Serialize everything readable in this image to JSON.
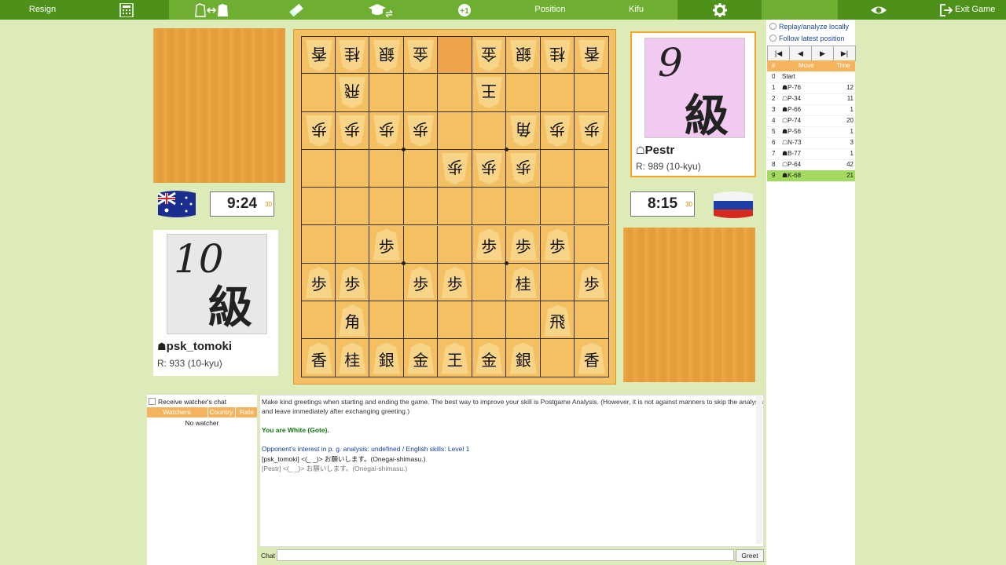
{
  "toolbar": {
    "resign": "Resign",
    "position": "Position",
    "kifu": "Kifu",
    "exit": "Exit Game"
  },
  "board": {
    "rows": [
      [
        [
          "香",
          "g"
        ],
        [
          "桂",
          "g"
        ],
        [
          "銀",
          "g"
        ],
        [
          "金",
          "g"
        ],
        null,
        [
          "金",
          "g"
        ],
        [
          "銀",
          "g"
        ],
        [
          "桂",
          "g"
        ],
        [
          "香",
          "g"
        ]
      ],
      [
        null,
        [
          "飛",
          "g"
        ],
        null,
        null,
        null,
        [
          "王",
          "g"
        ],
        null,
        null,
        null
      ],
      [
        [
          "歩",
          "g"
        ],
        [
          "歩",
          "g"
        ],
        [
          "歩",
          "g"
        ],
        [
          "歩",
          "g"
        ],
        null,
        null,
        [
          "角",
          "g"
        ],
        [
          "歩",
          "g"
        ],
        [
          "歩",
          "g"
        ]
      ],
      [
        null,
        null,
        null,
        null,
        [
          "歩",
          "g"
        ],
        [
          "歩",
          "g"
        ],
        [
          "歩",
          "g"
        ],
        null,
        null
      ],
      [
        null,
        null,
        null,
        null,
        null,
        null,
        null,
        null,
        null
      ],
      [
        null,
        null,
        [
          "歩",
          "s"
        ],
        null,
        null,
        [
          "歩",
          "s"
        ],
        [
          "歩",
          "s"
        ],
        [
          "歩",
          "s"
        ],
        null
      ],
      [
        [
          "歩",
          "s"
        ],
        [
          "歩",
          "s"
        ],
        null,
        [
          "歩",
          "s"
        ],
        [
          "歩",
          "s"
        ],
        null,
        [
          "桂",
          "s"
        ],
        null,
        [
          "歩",
          "s"
        ]
      ],
      [
        null,
        [
          "角",
          "s"
        ],
        null,
        null,
        null,
        null,
        null,
        [
          "飛",
          "s"
        ],
        null
      ],
      [
        [
          "香",
          "s"
        ],
        [
          "桂",
          "s"
        ],
        [
          "銀",
          "s"
        ],
        [
          "金",
          "s"
        ],
        [
          "王",
          "s"
        ],
        [
          "金",
          "s"
        ],
        [
          "銀",
          "s"
        ],
        null,
        [
          "香",
          "s"
        ]
      ]
    ],
    "highlight": [
      0,
      4
    ]
  },
  "players": {
    "sente": {
      "name": "psk_tomoki",
      "rating": "R: 933 (10-kyu)",
      "rank_num": "10",
      "rank_kanji": "級",
      "clock": "9:24",
      "byoyomi": "30",
      "country": "Australia"
    },
    "gote": {
      "name": "Pestr",
      "rating": "R: 989 (10-kyu)",
      "rank_num": "9",
      "rank_kanji": "級",
      "clock": "8:15",
      "byoyomi": "30",
      "country": "Russia"
    }
  },
  "kifu": {
    "options": [
      "Replay/analyze locally",
      "Follow latest position"
    ],
    "nav": [
      "|◀",
      "◀",
      "▶",
      "▶|"
    ],
    "headers": [
      "#",
      "Move",
      "Time"
    ],
    "moves": [
      {
        "n": "0",
        "side": "",
        "move": "Start",
        "time": ""
      },
      {
        "n": "1",
        "side": "☗",
        "move": "P-76",
        "time": "12"
      },
      {
        "n": "2",
        "side": "☖",
        "move": "P-34",
        "time": "11"
      },
      {
        "n": "3",
        "side": "☗",
        "move": "P-66",
        "time": "1"
      },
      {
        "n": "4",
        "side": "☖",
        "move": "P-74",
        "time": "20"
      },
      {
        "n": "5",
        "side": "☗",
        "move": "P-56",
        "time": "1"
      },
      {
        "n": "6",
        "side": "☖",
        "move": "N-73",
        "time": "3"
      },
      {
        "n": "7",
        "side": "☗",
        "move": "B-77",
        "time": "1"
      },
      {
        "n": "8",
        "side": "☖",
        "move": "P-64",
        "time": "42"
      },
      {
        "n": "9",
        "side": "☗",
        "move": "K-68",
        "time": "21"
      }
    ],
    "selected": 9
  },
  "watchers": {
    "receive_label": "Receive watcher's chat",
    "headers": [
      "Watchers",
      "Country",
      "Rate"
    ],
    "empty": "No watcher"
  },
  "chat": {
    "lines": [
      {
        "text": "Make kind greetings when starting and ending the game. The best way to improve your skill is Postgame Analysis. (However, it is not against manners to skip the analysis",
        "color": "#333"
      },
      {
        "text": "and leave immediately after exchanging greeting.)",
        "color": "#333"
      },
      {
        "text": "",
        "color": "#333"
      },
      {
        "text": "You are White (Gote).",
        "color": "#117711",
        "bold": true
      },
      {
        "text": "",
        "color": "#333"
      },
      {
        "text": "Opponent's interest in p. g. analysis: undefined / English skills: Level 1",
        "color": "#1a3f9a"
      },
      {
        "text": "[psk_tomoki] <(_ _)> お願いします。(Onegai-shimasu.)",
        "color": "#222"
      },
      {
        "text": "[Pestr] <(_ _)> お願いします。(Onegai-shimasu.)",
        "color": "#777"
      }
    ],
    "label": "Chat",
    "input_value": "",
    "greet": "Greet"
  },
  "colors": {
    "toolbar": "#6eaf32",
    "toolbar_dark": "#4e911a",
    "selected_row": "#a2db5f",
    "table_header": "#f5b35d"
  }
}
